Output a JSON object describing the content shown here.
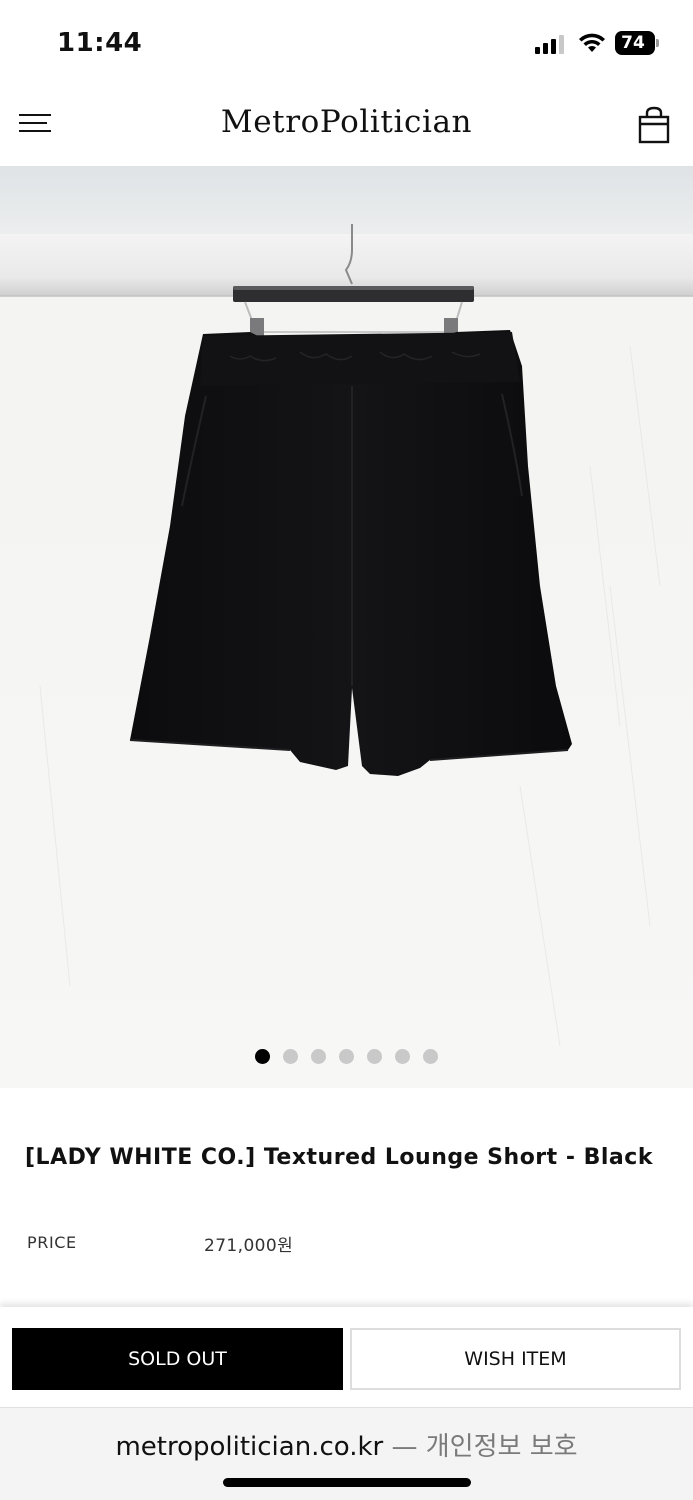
{
  "status_bar": {
    "time": "11:44",
    "battery": "74",
    "icons": [
      "signal-icon",
      "wifi-icon",
      "battery-icon"
    ]
  },
  "header": {
    "brand": "MetroPolitician",
    "menu_icon": "hamburger-menu-icon",
    "cart_icon": "shopping-bag-icon"
  },
  "product": {
    "image_alt": "black-shorts-on-hanger",
    "title": "[LADY WHITE CO.] Textured Lounge Short - Black",
    "price_label": "PRICE",
    "price_value": "271,000원",
    "image_count": 7,
    "active_image_index": 1
  },
  "actions": {
    "sold_out_label": "SOLD OUT",
    "wish_label": "WISH ITEM"
  },
  "browser": {
    "domain": "metropolitician.co.kr",
    "separator": " — ",
    "privacy_text": "개인정보 보호"
  },
  "colors": {
    "primary": "#000000",
    "background": "#ffffff",
    "dot_inactive": "#c9c9c9",
    "muted_text": "#7a7a7a"
  }
}
